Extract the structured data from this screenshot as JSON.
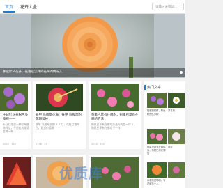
{
  "nav": {
    "home": "首页",
    "category": "花卉大全",
    "search_placeholder": "请输入关键词..."
  },
  "hero": {
    "caption": "那是什么花开，花语是怎样的花海的情况入"
  },
  "cards": [
    {
      "title": "千日红花开粉色多多模一一",
      "desc": "千日红花是一种花草植物科苋，千日红的花语是每一种",
      "meta": "2020 · 345"
    },
    {
      "title": "铁甲 鸟舰草花海：铁甲 鸟舰草的花期和长",
      "desc": "铁甲 鸟舰草花期 5-7 月，花色红艳夺目，观赏价值高",
      "meta": "2198 · 33"
    },
    {
      "title": "狗尾巴草有在哪的，狗尾巴草有在哪的方法",
      "desc": "狗尾巴草有在哪的方法好的是一样 1，狗尾巴草有在哪对于一样",
      "meta": "2020 · 345"
    }
  ],
  "sidebar": {
    "title": "热门文章",
    "items": [
      {
        "text": "桔梗放射鲜，粉色粉的性多种"
      },
      {
        "text": "洋甘菊"
      },
      {
        "text": "狗尾巴草有在哪和你，狗尾巴有在哪的"
      },
      {
        "text": "百合"
      },
      {
        "text": "杂粗有是哪和，有花鲜多一人"
      }
    ]
  },
  "watermark": "优质库"
}
